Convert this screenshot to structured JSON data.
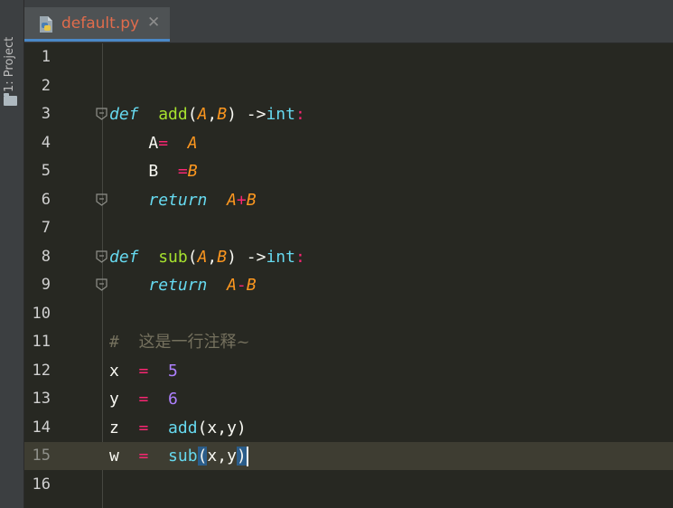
{
  "sidebar": {
    "project_tab_label": "1: Project",
    "project_icon": "folder-icon"
  },
  "tab": {
    "file_name": "default.py",
    "close_glyph": "✕",
    "icon": "python-file-icon"
  },
  "lines": [
    {
      "number": "1"
    },
    {
      "number": "2"
    },
    {
      "number": "3",
      "tokens": [
        [
          "kw",
          "def"
        ],
        [
          "",
          "  "
        ],
        [
          "fn",
          "add"
        ],
        [
          "",
          "("
        ],
        [
          "p",
          "A"
        ],
        [
          "",
          ","
        ],
        [
          "p",
          "B"
        ],
        [
          "",
          ") ->"
        ],
        [
          "bi",
          "int"
        ],
        [
          "op",
          ":"
        ]
      ]
    },
    {
      "number": "4",
      "tokens": [
        [
          "",
          "    A"
        ],
        [
          "op",
          "="
        ],
        [
          "",
          "  "
        ],
        [
          "p",
          "A"
        ]
      ]
    },
    {
      "number": "5",
      "tokens": [
        [
          "",
          "    B  "
        ],
        [
          "op",
          "="
        ],
        [
          "p",
          "B"
        ]
      ]
    },
    {
      "number": "6",
      "tokens": [
        [
          "",
          "    "
        ],
        [
          "kw",
          "return"
        ],
        [
          "",
          "  "
        ],
        [
          "p",
          "A"
        ],
        [
          "op",
          "+"
        ],
        [
          "p",
          "B"
        ]
      ]
    },
    {
      "number": "7"
    },
    {
      "number": "8",
      "tokens": [
        [
          "kw",
          "def"
        ],
        [
          "",
          "  "
        ],
        [
          "fn",
          "sub"
        ],
        [
          "",
          "("
        ],
        [
          "p",
          "A"
        ],
        [
          "",
          ","
        ],
        [
          "p",
          "B"
        ],
        [
          "",
          ") ->"
        ],
        [
          "bi",
          "int"
        ],
        [
          "op",
          ":"
        ]
      ]
    },
    {
      "number": "9",
      "tokens": [
        [
          "",
          "    "
        ],
        [
          "kw",
          "return"
        ],
        [
          "",
          "  "
        ],
        [
          "p",
          "A"
        ],
        [
          "op",
          "-"
        ],
        [
          "p",
          "B"
        ]
      ]
    },
    {
      "number": "10"
    },
    {
      "number": "11",
      "tokens": [
        [
          "cm",
          "#  "
        ],
        [
          "cm cn",
          "这是一行注释~"
        ]
      ]
    },
    {
      "number": "12",
      "tokens": [
        [
          "",
          "x  "
        ],
        [
          "op",
          "="
        ],
        [
          "",
          "  "
        ],
        [
          "num",
          "5"
        ]
      ]
    },
    {
      "number": "13",
      "tokens": [
        [
          "",
          "y  "
        ],
        [
          "op",
          "="
        ],
        [
          "",
          "  "
        ],
        [
          "num",
          "6"
        ]
      ]
    },
    {
      "number": "14",
      "tokens": [
        [
          "",
          "z  "
        ],
        [
          "op",
          "="
        ],
        [
          "",
          "  "
        ],
        [
          "bi",
          "add"
        ],
        [
          "",
          "(x,y)"
        ]
      ]
    },
    {
      "number": "15",
      "current": true,
      "tokens": [
        [
          "",
          "w  "
        ],
        [
          "op",
          "="
        ],
        [
          "",
          "  "
        ],
        [
          "bi",
          "sub"
        ],
        [
          "brk",
          "("
        ],
        [
          "",
          "x,y"
        ],
        [
          "brk",
          ")"
        ]
      ]
    },
    {
      "number": "16"
    }
  ],
  "fold_markers": [
    "3",
    "6",
    "8",
    "9"
  ],
  "colors": {
    "background": "#272822",
    "keyword": "#66d9ef",
    "function": "#a6e22e",
    "param": "#fd971f",
    "operator": "#f92672",
    "number": "#ae81ff",
    "comment": "#75715e"
  }
}
